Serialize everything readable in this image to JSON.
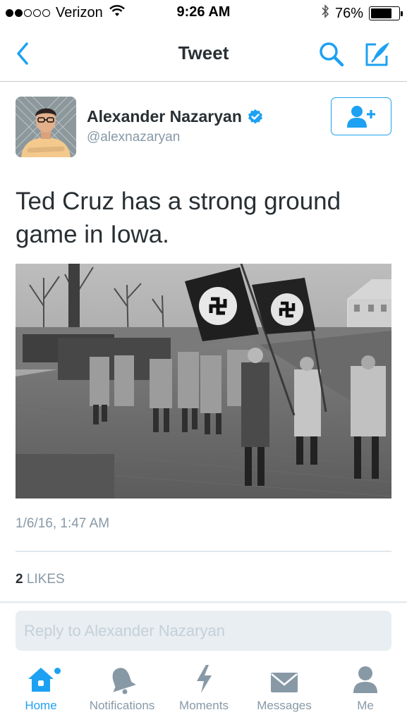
{
  "status_bar": {
    "carrier": "Verizon",
    "time": "9:26 AM",
    "battery": "76%",
    "battery_level": 0.76,
    "signal_bars_filled": 2,
    "signal_bars_total": 5
  },
  "nav": {
    "title": "Tweet",
    "back_icon": "chevron-left-icon",
    "search_icon": "search-icon",
    "compose_icon": "compose-icon"
  },
  "tweet": {
    "author_name": "Alexander Nazaryan",
    "author_handle": "@alexnazaryan",
    "verified": true,
    "text": "Ted Cruz has a strong ground game in Iowa.",
    "timestamp": "1/6/16, 1:47 AM",
    "likes_count": "2",
    "likes_label": "LIKES"
  },
  "reply": {
    "placeholder": "Reply to Alexander Nazaryan"
  },
  "tabs": [
    {
      "label": "Home",
      "icon": "home-icon",
      "active": true
    },
    {
      "label": "Notifications",
      "icon": "bell-icon",
      "active": false
    },
    {
      "label": "Moments",
      "icon": "lightning-icon",
      "active": false
    },
    {
      "label": "Messages",
      "icon": "envelope-icon",
      "active": false
    },
    {
      "label": "Me",
      "icon": "person-icon",
      "active": false
    }
  ],
  "colors": {
    "accent": "#1da1f2",
    "text": "#292f33",
    "muted": "#8899a6",
    "tab_inactive": "#8899a6",
    "reply_bg": "#e8eef2"
  }
}
